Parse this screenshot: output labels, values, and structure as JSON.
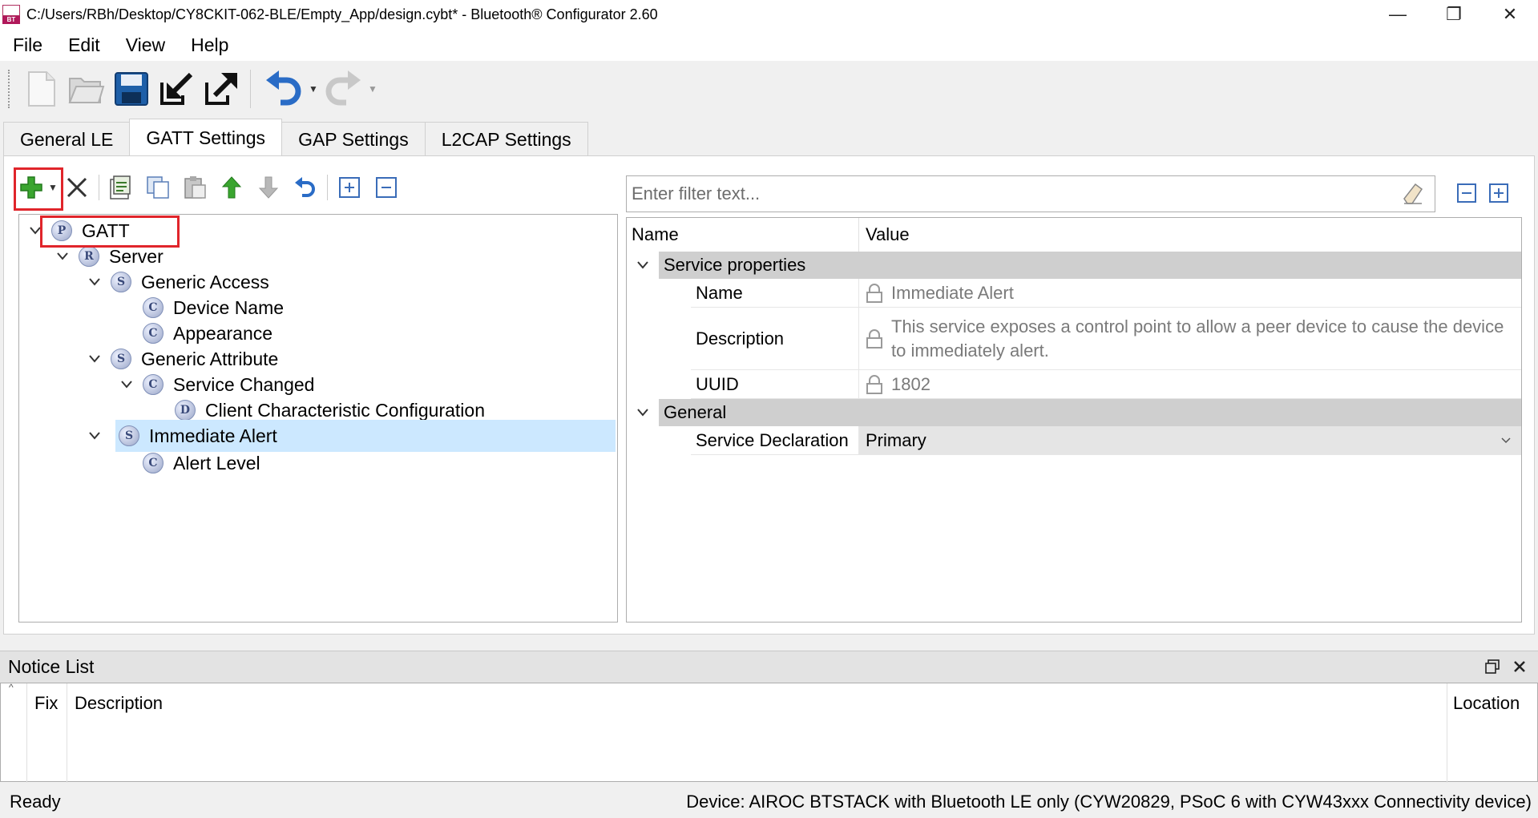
{
  "window": {
    "title": "C:/Users/RBh/Desktop/CY8CKIT-062-BLE/Empty_App/design.cybt* - Bluetooth® Configurator 2.60",
    "icon_label": "BT",
    "minimize_glyph": "—",
    "restore_glyph": "❐",
    "close_glyph": "✕"
  },
  "menu": [
    "File",
    "Edit",
    "View",
    "Help"
  ],
  "tabs": [
    {
      "label": "General LE",
      "active": false
    },
    {
      "label": "GATT Settings",
      "active": true
    },
    {
      "label": "GAP Settings",
      "active": false
    },
    {
      "label": "L2CAP Settings",
      "active": false
    }
  ],
  "tree": [
    {
      "label": "GATT",
      "icon": "P",
      "level": 0,
      "expanded": true,
      "selected": false
    },
    {
      "label": "Server",
      "icon": "R",
      "level": 1,
      "expanded": true,
      "selected": false
    },
    {
      "label": "Generic Access",
      "icon": "S",
      "level": 2,
      "expanded": true,
      "selected": false
    },
    {
      "label": "Device Name",
      "icon": "C",
      "level": 3,
      "expanded": null,
      "selected": false
    },
    {
      "label": "Appearance",
      "icon": "C",
      "level": 3,
      "expanded": null,
      "selected": false
    },
    {
      "label": "Generic Attribute",
      "icon": "S",
      "level": 2,
      "expanded": true,
      "selected": false
    },
    {
      "label": "Service Changed",
      "icon": "C",
      "level": 3,
      "expanded": true,
      "selected": false
    },
    {
      "label": "Client Characteristic Configuration",
      "icon": "D",
      "level": 4,
      "expanded": null,
      "selected": false
    },
    {
      "label": "Immediate Alert",
      "icon": "S",
      "level": 2,
      "expanded": true,
      "selected": true
    },
    {
      "label": "Alert Level",
      "icon": "C",
      "level": 3,
      "expanded": null,
      "selected": false
    }
  ],
  "filter": {
    "placeholder": "Enter filter text..."
  },
  "properties": {
    "header_name": "Name",
    "header_value": "Value",
    "categories": [
      {
        "title": "Service properties",
        "rows": [
          {
            "name": "Name",
            "value": "Immediate Alert",
            "locked": true
          },
          {
            "name": "Description",
            "value": "This service exposes a control point to allow a peer device to cause the device to immediately alert.",
            "locked": true
          },
          {
            "name": "UUID",
            "value": "1802",
            "locked": true
          }
        ]
      },
      {
        "title": "General",
        "rows": [
          {
            "name": "Service Declaration",
            "value": "Primary",
            "locked": false,
            "dropdown": true
          }
        ]
      }
    ]
  },
  "notice": {
    "title": "Notice List",
    "columns": [
      "Fix",
      "Description",
      "Location"
    ]
  },
  "status": {
    "left": "Ready",
    "right": "Device: AIROC BTSTACK with Bluetooth LE only (CYW20829, PSoC 6 with CYW43xxx Connectivity device)"
  },
  "colors": {
    "highlight_box": "#e0252b",
    "selection": "#cce8ff",
    "category_bg": "#cfcfcf"
  }
}
